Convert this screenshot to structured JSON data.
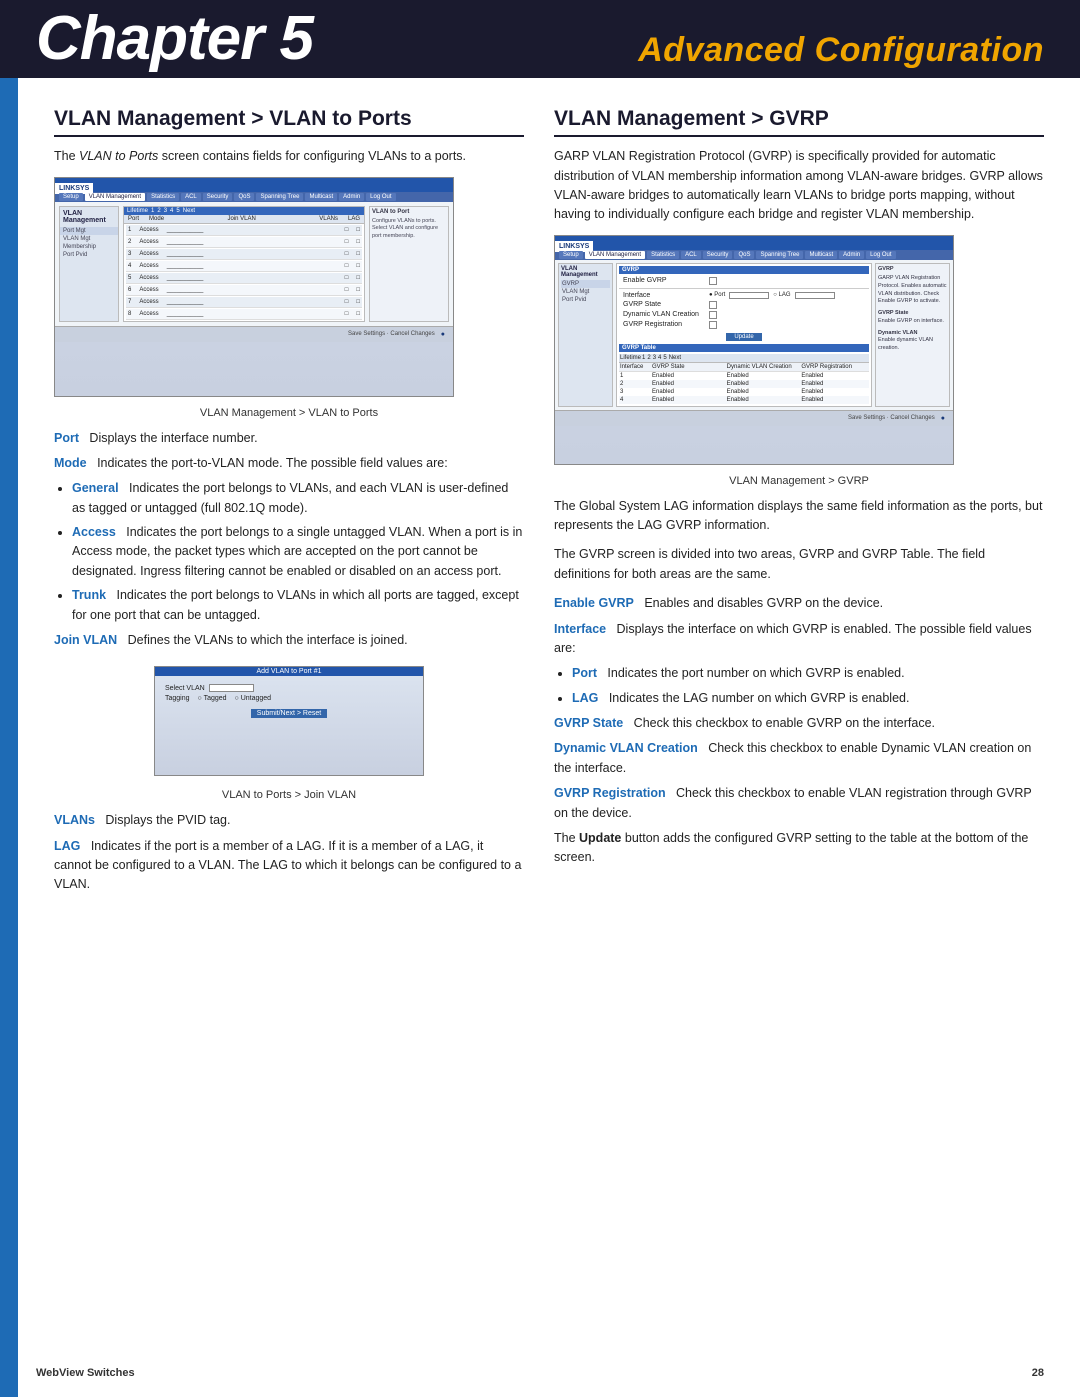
{
  "header": {
    "chapter_label": "Chapter 5",
    "title_label": "Advanced Configuration"
  },
  "left_section": {
    "heading": "VLAN Management > VLAN to Ports",
    "intro_text": "The VLAN to Ports screen contains fields for configuring VLANs to a ports.",
    "screen1_caption": "VLAN Management > VLAN to Ports",
    "field_port_name": "Port",
    "field_port_desc": "Displays the interface number.",
    "field_mode_name": "Mode",
    "field_mode_desc": "Indicates the port-to-VLAN mode. The possible field values are:",
    "bullet_general_name": "General",
    "bullet_general_desc": "Indicates the port belongs to VLANs, and each VLAN is user-defined as tagged or untagged (full 802.1Q mode).",
    "bullet_access_name": "Access",
    "bullet_access_desc": "Indicates the port belongs to a single untagged VLAN. When a port is in Access mode, the packet types which are accepted on the port cannot be designated. Ingress filtering cannot be enabled or disabled on an access port.",
    "bullet_trunk_name": "Trunk",
    "bullet_trunk_desc": "Indicates the port belongs to VLANs in which all ports are tagged, except for one port that can be untagged.",
    "field_joinvlan_name": "Join VLAN",
    "field_joinvlan_desc": "Defines the VLANs to which the interface is joined.",
    "screen2_caption": "VLAN to Ports > Join VLAN",
    "field_vlans_name": "VLANs",
    "field_vlans_desc": "Displays the PVID tag.",
    "field_lag_name": "LAG",
    "field_lag_desc": "Indicates if the port is a member of a LAG. If it is a member of a LAG, it cannot be configured to a VLAN. The LAG to which it belongs can be configured to a VLAN."
  },
  "right_section": {
    "heading": "VLAN Management > GVRP",
    "intro_text": "GARP VLAN Registration Protocol (GVRP) is specifically provided for automatic distribution of VLAN membership information among VLAN-aware bridges. GVRP allows VLAN-aware bridges to automatically learn VLANs to bridge ports mapping, without having to individually configure each bridge and register VLAN membership.",
    "screen_caption": "VLAN Management > GVRP",
    "global_system_text": "The Global System LAG information displays the same field information as the ports, but represents the LAG GVRP information.",
    "gvrp_screen_divided": "The GVRP screen is divided into two areas, GVRP and GVRP Table. The field definitions for both areas are the same.",
    "enable_gvrp_name": "Enable GVRP",
    "enable_gvrp_desc": "Enables and disables GVRP on the device.",
    "interface_name": "Interface",
    "interface_desc": "Displays the interface on which GVRP is enabled. The possible field values are:",
    "bullet_port_name": "Port",
    "bullet_port_desc": "Indicates the port number on which GVRP is enabled.",
    "bullet_lag_name": "LAG",
    "bullet_lag_desc": "Indicates the LAG number on which GVRP is enabled.",
    "gvrp_state_name": "GVRP State",
    "gvrp_state_desc": "Check this checkbox to enable GVRP on the interface.",
    "dynamic_vlan_name": "Dynamic VLAN Creation",
    "dynamic_vlan_desc": "Check this checkbox to enable Dynamic VLAN creation on the interface.",
    "gvrp_reg_name": "GVRP Registration",
    "gvrp_reg_desc": "Check this checkbox to enable VLAN registration through GVRP on the device.",
    "update_desc": "The Update button adds the configured GVRP setting to the table at the bottom of the screen."
  },
  "footer": {
    "left": "WebView Switches",
    "right": "28"
  }
}
